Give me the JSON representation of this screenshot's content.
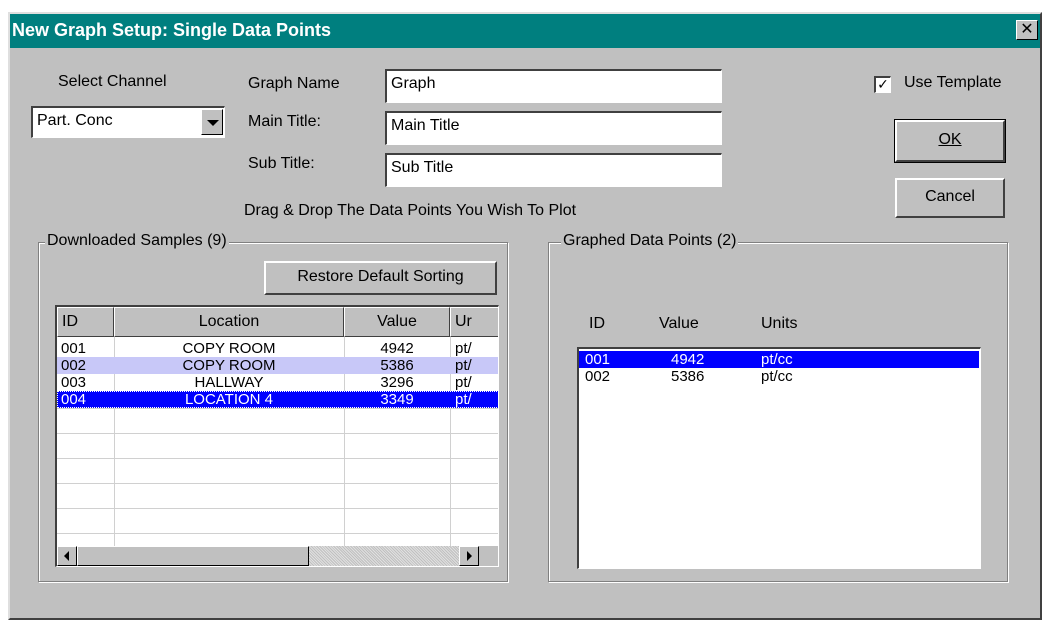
{
  "window": {
    "title": "New Graph Setup: Single Data Points",
    "close_label": "✕"
  },
  "channel": {
    "label": "Select Channel",
    "selected": "Part. Conc"
  },
  "graph_name": {
    "label": "Graph Name",
    "value": "Graph"
  },
  "main_title": {
    "label": "Main Title:",
    "value": "Main Title"
  },
  "sub_title": {
    "label": "Sub Title:",
    "value": "Sub Title"
  },
  "use_template": {
    "label": "Use Template",
    "checked": true
  },
  "buttons": {
    "ok": "OK",
    "cancel": "Cancel",
    "restore": "Restore Default Sorting"
  },
  "instruction": "Drag & Drop The Data Points You Wish To Plot",
  "downloaded": {
    "legend": "Downloaded Samples (9)",
    "columns": [
      "ID",
      "Location",
      "Value",
      "Ur"
    ],
    "rows": [
      {
        "id": "001",
        "location": "COPY ROOM",
        "value": "4942",
        "units": "pt/"
      },
      {
        "id": "002",
        "location": "COPY ROOM",
        "value": "5386",
        "units": "pt/"
      },
      {
        "id": "003",
        "location": "HALLWAY",
        "value": "3296",
        "units": "pt/"
      },
      {
        "id": "004",
        "location": "LOCATION 4",
        "value": "3349",
        "units": "pt/"
      }
    ]
  },
  "graphed": {
    "legend": "Graphed Data Points (2)",
    "columns": [
      "ID",
      "Value",
      "Units"
    ],
    "rows": [
      {
        "id": "001",
        "value": "4942",
        "units": "pt/cc"
      },
      {
        "id": "002",
        "value": "5386",
        "units": "pt/cc"
      }
    ]
  },
  "colors": {
    "titlebar": "#007f7f",
    "face": "#c0c0c0",
    "selection": "#0000ff",
    "highlight": "#c8c8f8"
  }
}
